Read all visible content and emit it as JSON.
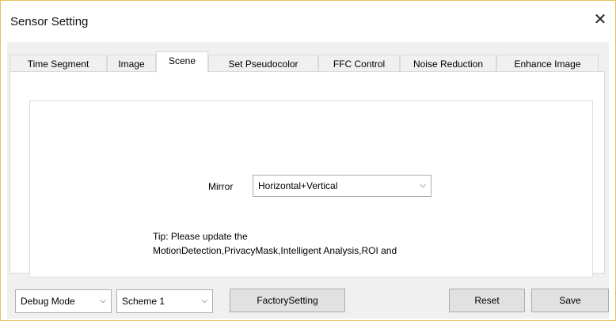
{
  "window": {
    "title": "Sensor Setting",
    "close_glyph": "✕"
  },
  "tabs": [
    {
      "label": "Time Segment",
      "active": false
    },
    {
      "label": "Image",
      "active": false
    },
    {
      "label": "Scene",
      "active": true
    },
    {
      "label": "Set Pseudocolor",
      "active": false
    },
    {
      "label": "FFC Control",
      "active": false
    },
    {
      "label": "Noise Reduction",
      "active": false
    },
    {
      "label": "Enhance Image",
      "active": false
    }
  ],
  "scene": {
    "mirror_label": "Mirror",
    "mirror_value": "Horizontal+Vertical",
    "tip_line1": "Tip: Please update the",
    "tip_line2": "MotionDetection,PrivacyMask,Intelligent Analysis,ROI and"
  },
  "footer": {
    "debug_mode": "Debug Mode",
    "scheme": "Scheme 1",
    "factory_setting": "FactorySetting",
    "reset": "Reset",
    "save": "Save"
  },
  "icons": {
    "dropdown": "chevron-down-icon",
    "close": "close-icon"
  },
  "colors": {
    "window_border": "#e6c25a",
    "client_bg": "#f0f0f0",
    "button_bg": "#e1e1e1"
  }
}
